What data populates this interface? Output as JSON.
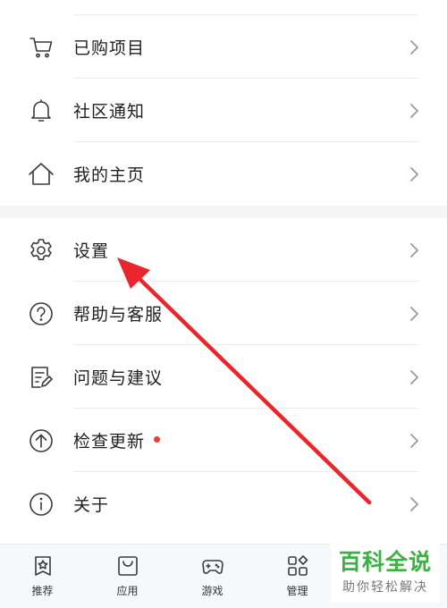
{
  "group1": [
    {
      "id": "purchased",
      "label": "已购项目",
      "icon": "cart-icon"
    },
    {
      "id": "notice",
      "label": "社区通知",
      "icon": "bell-icon"
    },
    {
      "id": "home",
      "label": "我的主页",
      "icon": "home-icon"
    }
  ],
  "group2": [
    {
      "id": "settings",
      "label": "设置",
      "icon": "gear-icon"
    },
    {
      "id": "help",
      "label": "帮助与客服",
      "icon": "question-icon"
    },
    {
      "id": "feedback",
      "label": "问题与建议",
      "icon": "edit-doc-icon"
    },
    {
      "id": "update",
      "label": "检查更新",
      "icon": "upload-circle-icon",
      "badge_dot": true
    },
    {
      "id": "about",
      "label": "关于",
      "icon": "info-icon"
    }
  ],
  "tabbar": [
    {
      "label": "推荐",
      "icon": "star-bookmark-icon"
    },
    {
      "label": "应用",
      "icon": "bag-icon"
    },
    {
      "label": "游戏",
      "icon": "gamepad-icon"
    },
    {
      "label": "管理",
      "icon": "grid-icon"
    }
  ],
  "watermark": {
    "title": "百科全说",
    "subtitle": "助你轻松解决"
  },
  "colors": {
    "accent_dot": "#e8412d",
    "annotation_arrow": "#e8262b",
    "watermark_green": "#3db043"
  }
}
